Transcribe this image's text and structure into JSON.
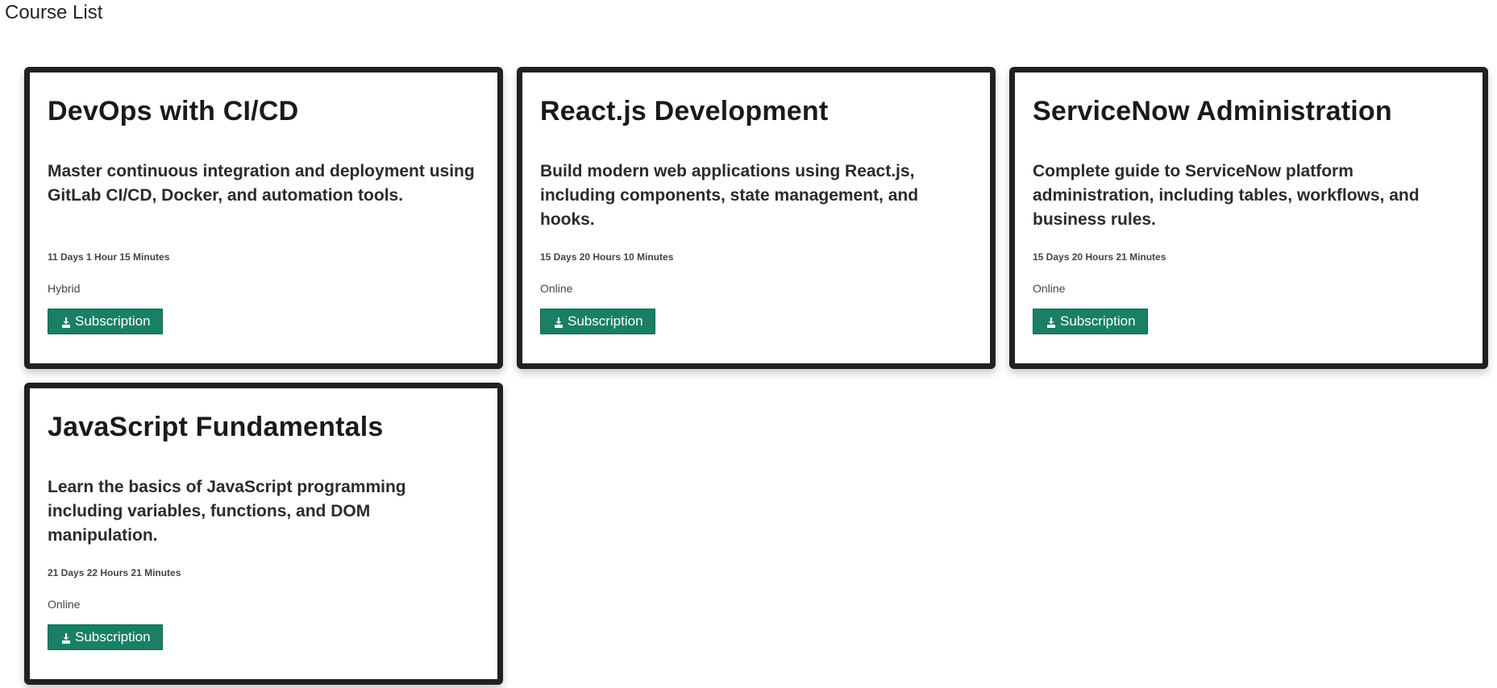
{
  "page": {
    "title": "Course List"
  },
  "courses": [
    {
      "title": "DevOps with CI/CD",
      "description": "Master continuous integration and deployment using GitLab CI/CD, Docker, and automation tools.",
      "duration": "11 Days 1 Hour 15 Minutes",
      "mode": "Hybrid",
      "button_label": "Subscription",
      "button_icon": "download-icon"
    },
    {
      "title": "React.js Development",
      "description": "Build modern web applications using React.js, including components, state management, and hooks.",
      "duration": "15 Days 20 Hours 10 Minutes",
      "mode": "Online",
      "button_label": "Subscription",
      "button_icon": "download-icon"
    },
    {
      "title": "ServiceNow Administration",
      "description": "Complete guide to ServiceNow platform administration, including tables, workflows, and business rules.",
      "duration": "15 Days 20 Hours 21 Minutes",
      "mode": "Online",
      "button_label": "Subscription",
      "button_icon": "download-icon"
    },
    {
      "title": "JavaScript Fundamentals",
      "description": "Learn the basics of JavaScript programming including variables, functions, and DOM manipulation.",
      "duration": "21 Days 22 Hours 21 Minutes",
      "mode": "Online",
      "button_label": "Subscription",
      "button_icon": "download-icon"
    }
  ],
  "colors": {
    "button_bg": "#1a7f64",
    "card_border": "#1e2222"
  }
}
